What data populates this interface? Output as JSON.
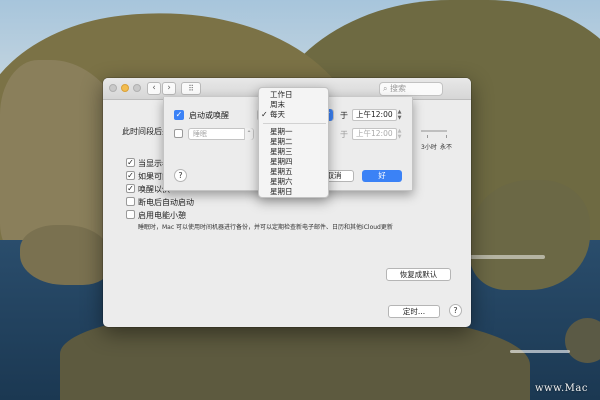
{
  "window": {
    "search_placeholder": "搜索",
    "nav_back": "‹",
    "nav_forward": "›",
    "grid_icon": "grid-icon",
    "sleep_label_partial": "此时间段后关",
    "slider_labels": [
      "3小时",
      "永不"
    ],
    "options": [
      {
        "label": "当显示器",
        "checked": true
      },
      {
        "label": "如果可能",
        "checked": true
      },
      {
        "label": "唤醒以供",
        "checked": true
      },
      {
        "label": "断电后自动启动",
        "checked": false
      },
      {
        "label": "启用电能小憩",
        "checked": false
      }
    ],
    "power_nap_desc": "睡眠时，Mac 可以使用时间机器进行备份，并可以定期检查新电子邮件、日历和其他iCloud更新",
    "restore_defaults": "恢复成默认",
    "schedule_button": "定时...",
    "help": "?"
  },
  "sheet": {
    "row1": {
      "checked": true,
      "label": "启动或唤醒",
      "time_prefix": "于",
      "time": "上午12:00"
    },
    "row2": {
      "checked": false,
      "action": "睡眠",
      "time_prefix": "于",
      "time": "上午12:00"
    },
    "help": "?",
    "cancel": "取消",
    "ok": "好"
  },
  "menu": {
    "group1": [
      "工作日",
      "周末",
      "每天"
    ],
    "selected": "每天",
    "group2": [
      "星期一",
      "星期二",
      "星期三",
      "星期四",
      "星期五",
      "星期六",
      "星期日"
    ]
  },
  "watermark": "www.Mac",
  "colors": {
    "accent": "#3b82f6",
    "window": "#ececec",
    "traffic_yellow": "#f3bd4f"
  }
}
